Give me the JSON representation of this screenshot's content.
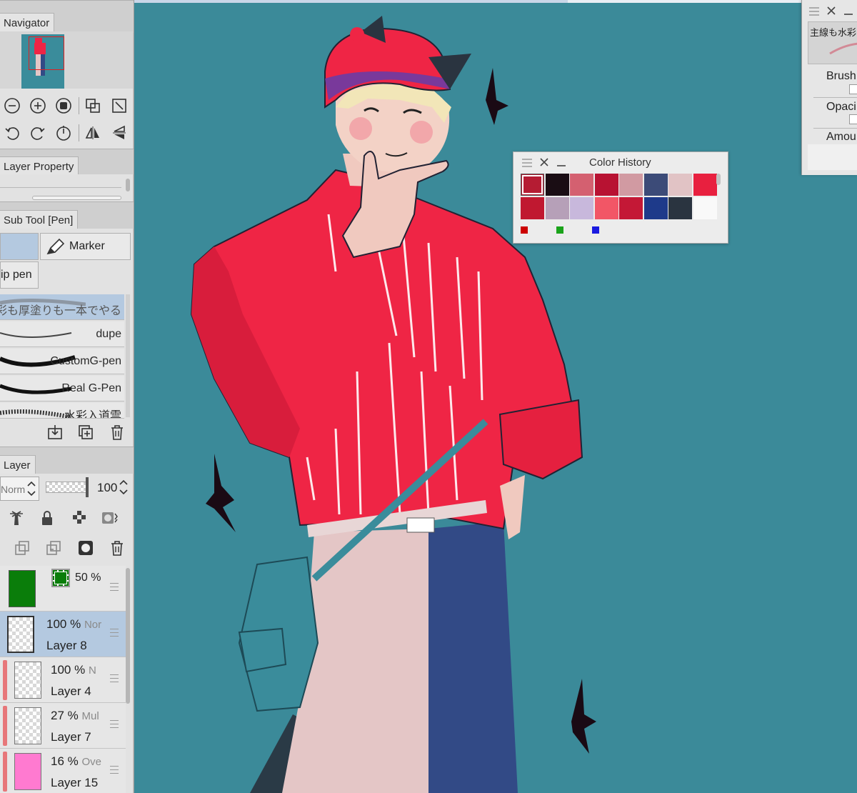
{
  "left_panel": {
    "navigator": {
      "tab_label": "Navigator"
    },
    "layer_property": {
      "tab_label": "Layer Property"
    },
    "sub_tool": {
      "tab_label": "Sub Tool [Pen]",
      "tools": [
        {
          "label": "Marker"
        },
        {
          "label": "ip pen"
        }
      ],
      "brushes": [
        {
          "label": "彩も厚塗りも一本でやる"
        },
        {
          "label": "dupe"
        },
        {
          "label": "CustomG-pen"
        },
        {
          "label": "Real G-Pen"
        },
        {
          "label": "水彩入道雲"
        }
      ]
    },
    "layer": {
      "tab_label": "Layer",
      "blend_mode": "Norm",
      "opacity": "100",
      "color_layer": {
        "opacity": "50 %",
        "color": "#0a7d0a"
      },
      "layers": [
        {
          "opacity": "100 %",
          "mode": "Nor",
          "name": "Layer 8",
          "selected": true
        },
        {
          "opacity": "100 %",
          "mode": "N",
          "name": "Layer 4"
        },
        {
          "opacity": "27 %",
          "mode": "Mul",
          "name": "Layer 7"
        },
        {
          "opacity": "16 %",
          "mode": "Ove",
          "name": "Layer 15"
        }
      ]
    }
  },
  "color_history": {
    "title": "Color History",
    "swatches": [
      "#b51c33",
      "#1a0d14",
      "#d46070",
      "#b81232",
      "#d19aa2",
      "#3c4b78",
      "#e1c3c5",
      "#e8203f",
      "#c01830",
      "#b6a0b8",
      "#c8b8dc",
      "#f25666",
      "#c41836",
      "#1e3a8a",
      "#2a3440",
      "#f9f9f9"
    ],
    "bottom_colors": [
      "#cc0000",
      "#1aa31a",
      "#1a1ae0"
    ]
  },
  "right_panel": {
    "header_text": "主線も水彩も",
    "labels": [
      "Brush",
      "Opaci",
      "Amou"
    ]
  }
}
